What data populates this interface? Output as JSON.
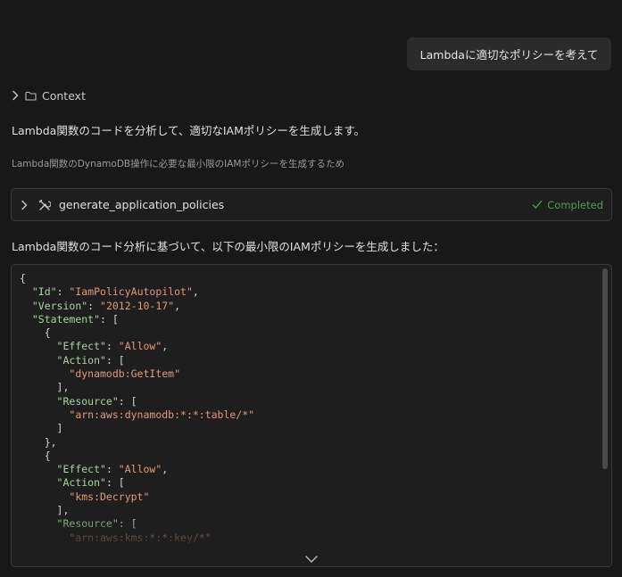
{
  "header_strip": {
    "text": "·  ·  ·  ·  ·  ·  ·  ·  ·"
  },
  "user_message": {
    "text": "Lambdaに適切なポリシーを考えて"
  },
  "context": {
    "label": "Context",
    "icon": "folder-icon"
  },
  "assistant": {
    "intro": "Lambda関数のコードを分析して、適切なIAMポリシーを生成します。",
    "reason": "Lambda関数のDynamoDB操作に必要な最小限のIAMポリシーを生成するため",
    "tool_call": {
      "name": "generate_application_policies",
      "status": "Completed",
      "icon": "tools-icon",
      "status_color": "#4e9a4e"
    },
    "summary": "Lambda関数のコード分析に基づいて、以下の最小限のIAMポリシーを生成しました："
  },
  "code": {
    "lines": [
      [
        [
          "p",
          "{"
        ]
      ],
      [
        [
          "p",
          "  "
        ],
        [
          "k",
          "\"Id\""
        ],
        [
          "p",
          ": "
        ],
        [
          "s",
          "\"IamPolicyAutopilot\""
        ],
        [
          "p",
          ","
        ]
      ],
      [
        [
          "p",
          "  "
        ],
        [
          "k",
          "\"Version\""
        ],
        [
          "p",
          ": "
        ],
        [
          "s",
          "\"2012-10-17\""
        ],
        [
          "p",
          ","
        ]
      ],
      [
        [
          "p",
          "  "
        ],
        [
          "k",
          "\"Statement\""
        ],
        [
          "p",
          ": ["
        ]
      ],
      [
        [
          "p",
          "    {"
        ]
      ],
      [
        [
          "p",
          "      "
        ],
        [
          "k",
          "\"Effect\""
        ],
        [
          "p",
          ": "
        ],
        [
          "s",
          "\"Allow\""
        ],
        [
          "p",
          ","
        ]
      ],
      [
        [
          "p",
          "      "
        ],
        [
          "k",
          "\"Action\""
        ],
        [
          "p",
          ": ["
        ]
      ],
      [
        [
          "p",
          "        "
        ],
        [
          "s",
          "\"dynamodb:GetItem\""
        ]
      ],
      [
        [
          "p",
          "      ],"
        ]
      ],
      [
        [
          "p",
          "      "
        ],
        [
          "k",
          "\"Resource\""
        ],
        [
          "p",
          ": ["
        ]
      ],
      [
        [
          "p",
          "        "
        ],
        [
          "s",
          "\"arn:aws:dynamodb:*:*:table/*\""
        ]
      ],
      [
        [
          "p",
          "      ]"
        ]
      ],
      [
        [
          "p",
          "    },"
        ]
      ],
      [
        [
          "p",
          "    {"
        ]
      ],
      [
        [
          "p",
          "      "
        ],
        [
          "k",
          "\"Effect\""
        ],
        [
          "p",
          ": "
        ],
        [
          "s",
          "\"Allow\""
        ],
        [
          "p",
          ","
        ]
      ],
      [
        [
          "p",
          "      "
        ],
        [
          "k",
          "\"Action\""
        ],
        [
          "p",
          ": ["
        ]
      ],
      [
        [
          "p",
          "        "
        ],
        [
          "s",
          "\"kms:Decrypt\""
        ]
      ],
      [
        [
          "p",
          "      ],"
        ]
      ],
      [
        [
          "p",
          "      "
        ],
        [
          "k",
          "\"Resource\""
        ],
        [
          "p",
          ": ["
        ]
      ],
      [
        [
          "p",
          "        "
        ],
        [
          "s",
          "\"arn:aws:kms:*:*:key/*\""
        ]
      ]
    ]
  },
  "colors": {
    "background": "#181818",
    "json_key": "#a8d4a0",
    "json_string": "#e29a78",
    "success": "#4e9a4e"
  }
}
